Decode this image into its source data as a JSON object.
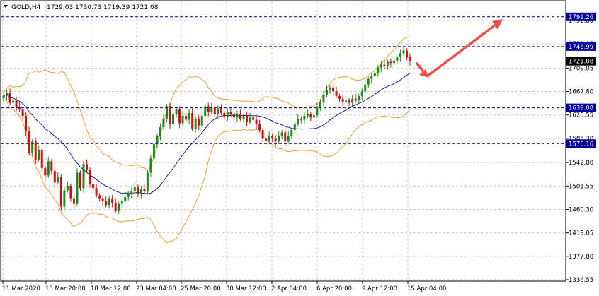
{
  "symbol_header": {
    "symbol": "GOLD,H4",
    "ohlc": "1729.03 1730.73 1719.39 1721.08"
  },
  "colors": {
    "background": "#ffffff",
    "grid": "#c8c8c8",
    "candle_up": "#1e8a1e",
    "candle_down": "#d01010",
    "bollinger": "#f0a030",
    "moving_average": "#1a1aa8",
    "level_line": "#000080",
    "level_tag": "#0000a0",
    "price_tag": "#000000",
    "arrow": "#e8524a"
  },
  "price_axis": {
    "ticks": [
      "1792.80",
      "1751.85",
      "1709.05",
      "1667.80",
      "1626.55",
      "1585.30",
      "1542.80",
      "1501.55",
      "1460.30",
      "1419.05",
      "1377.80",
      "1336.55"
    ]
  },
  "time_axis": {
    "ticks": [
      "11 Mar 2020",
      "13 Mar 20:00",
      "18 Mar 12:00",
      "23 Mar 04:00",
      "25 Mar 20:00",
      "30 Mar 12:00",
      "2 Apr 04:00",
      "6 Apr 20:00",
      "9 Apr 12:00",
      "15 Apr 04:00"
    ]
  },
  "levels": [
    {
      "label": "1799.26",
      "value": 1799.26
    },
    {
      "label": "1746.99",
      "value": 1746.99
    },
    {
      "label": "1639.08",
      "value": 1639.08
    },
    {
      "label": "1576.16",
      "value": 1576.16
    }
  ],
  "current_price": {
    "label": "1721.08",
    "value": 1721.08
  },
  "chart_data": {
    "type": "candlestick",
    "title": "",
    "ylim": [
      1330,
      1812
    ],
    "close_series": [
      1660,
      1665,
      1648,
      1652,
      1641,
      1636,
      1625,
      1598,
      1560,
      1580,
      1548,
      1565,
      1533,
      1520,
      1545,
      1528,
      1508,
      1518,
      1465,
      1494,
      1502,
      1480,
      1470,
      1525,
      1498,
      1540,
      1530,
      1505,
      1498,
      1485,
      1480,
      1475,
      1468,
      1480,
      1472,
      1458,
      1470,
      1475,
      1482,
      1488,
      1493,
      1500,
      1488,
      1496,
      1492,
      1525,
      1550,
      1575,
      1590,
      1605,
      1620,
      1642,
      1610,
      1628,
      1636,
      1612,
      1625,
      1618,
      1630,
      1602,
      1620,
      1608,
      1625,
      1642,
      1632,
      1640,
      1628,
      1638,
      1630,
      1624,
      1632,
      1628,
      1622,
      1628,
      1620,
      1625,
      1615,
      1622,
      1618,
      1610,
      1600,
      1585,
      1580,
      1590,
      1585,
      1580,
      1590,
      1596,
      1580,
      1590,
      1600,
      1610,
      1620,
      1618,
      1625,
      1628,
      1622,
      1626,
      1640,
      1650,
      1662,
      1670,
      1675,
      1668,
      1660,
      1655,
      1650,
      1652,
      1648,
      1655,
      1652,
      1660,
      1668,
      1680,
      1690,
      1695,
      1700,
      1710,
      1715,
      1712,
      1720,
      1718,
      1722,
      1728,
      1735,
      1740,
      1729,
      1721
    ]
  }
}
